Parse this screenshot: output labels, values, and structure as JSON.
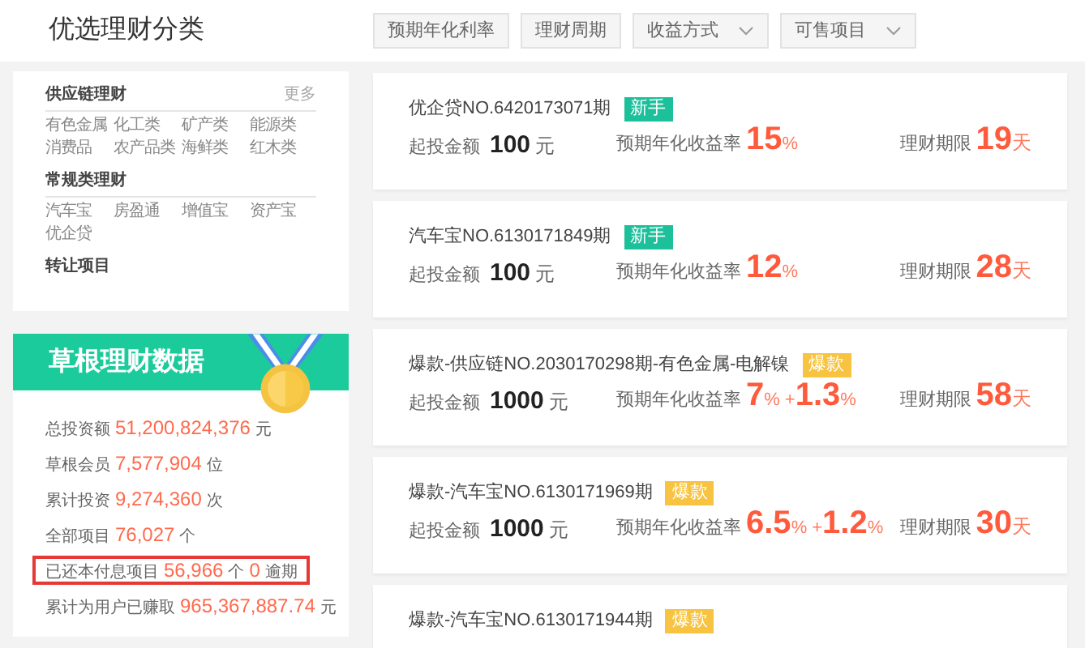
{
  "header": {
    "title": "优选理财分类"
  },
  "filters": [
    {
      "label": "预期年化利率",
      "dropdown": false
    },
    {
      "label": "理财周期",
      "dropdown": false
    },
    {
      "label": "收益方式",
      "dropdown": true
    },
    {
      "label": "可售项目",
      "dropdown": true
    }
  ],
  "categories": [
    {
      "heading": "供应链理财",
      "more": "更多",
      "items": [
        "有色金属",
        "化工类",
        "矿产类",
        "能源类",
        "消费品",
        "农产品类",
        "海鲜类",
        "红木类"
      ]
    },
    {
      "heading": "常规类理财",
      "items": [
        "汽车宝",
        "房盈通",
        "增值宝",
        "资产宝",
        "优企贷"
      ]
    },
    {
      "heading": "转让项目"
    }
  ],
  "stats": {
    "title": "草根理财数据",
    "rows": [
      {
        "label": "总投资额",
        "value": "51,200,824,376",
        "unit": "元",
        "highlighted": false
      },
      {
        "label": "草根会员",
        "value": "7,577,904",
        "unit": "位",
        "highlighted": false
      },
      {
        "label": "累计投资",
        "value": "9,274,360",
        "unit": "次",
        "highlighted": false
      },
      {
        "label": "全部项目",
        "value": "76,027",
        "unit": "个",
        "highlighted": false
      },
      {
        "label": "已还本付息项目",
        "value": "56,966",
        "unit": "个",
        "extra_value": "0",
        "extra_unit": "逾期",
        "highlighted": true
      },
      {
        "label": "累计为用户已赚取",
        "value": "965,367,887.74",
        "unit": "元",
        "highlighted": false
      }
    ]
  },
  "products": [
    {
      "name": "优企贷NO.6420173071期",
      "badge": {
        "kind": "new",
        "label": "新手"
      },
      "amount_label": "起投金额",
      "amount": "100",
      "amount_unit": "元",
      "rate_label": "预期年化收益率",
      "rate": "15",
      "rate_unit": "%",
      "term_label": "理财期限",
      "term": "19",
      "term_unit": "天"
    },
    {
      "name": "汽车宝NO.6130171849期",
      "badge": {
        "kind": "new",
        "label": "新手"
      },
      "amount_label": "起投金额",
      "amount": "100",
      "amount_unit": "元",
      "rate_label": "预期年化收益率",
      "rate": "12",
      "rate_unit": "%",
      "term_label": "理财期限",
      "term": "28",
      "term_unit": "天"
    },
    {
      "name": "爆款-供应链NO.2030170298期-有色金属-电解镍",
      "badge": {
        "kind": "hot",
        "label": "爆款"
      },
      "amount_label": "起投金额",
      "amount": "1000",
      "amount_unit": "元",
      "rate_label": "预期年化收益率",
      "rate": "7",
      "rate_unit": "%",
      "bonus_sign": "+",
      "bonus": "1.3",
      "bonus_unit": "%",
      "term_label": "理财期限",
      "term": "58",
      "term_unit": "天"
    },
    {
      "name": "爆款-汽车宝NO.6130171969期",
      "badge": {
        "kind": "hot",
        "label": "爆款"
      },
      "amount_label": "起投金额",
      "amount": "1000",
      "amount_unit": "元",
      "rate_label": "预期年化收益率",
      "rate": "6.5",
      "rate_unit": "%",
      "bonus_sign": "+",
      "bonus": "1.2",
      "bonus_unit": "%",
      "term_label": "理财期限",
      "term": "30",
      "term_unit": "天"
    },
    {
      "name": "爆款-汽车宝NO.6130171944期",
      "badge": {
        "kind": "hot",
        "label": "爆款"
      }
    }
  ]
}
